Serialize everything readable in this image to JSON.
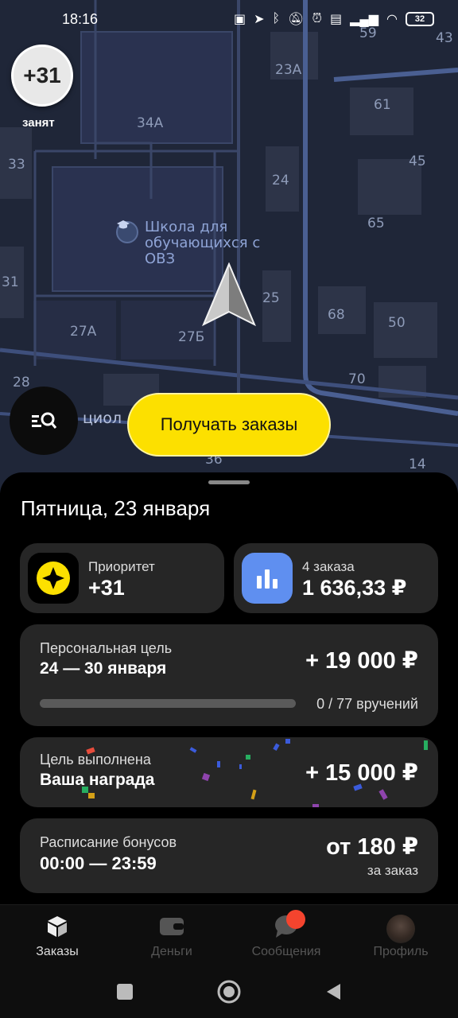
{
  "status_bar": {
    "time": "18:16",
    "battery": "32"
  },
  "map": {
    "labels": {
      "l_34a": "34А",
      "l_23a": "23А",
      "l_61": "61",
      "l_45": "45",
      "l_33": "33",
      "l_24": "24",
      "l_65": "65",
      "l_31": "31",
      "l_25": "25",
      "l_68": "68",
      "l_50": "50",
      "l_27a": "27А",
      "l_27b": "27Б",
      "l_70": "70",
      "l_28": "28",
      "l_36": "36",
      "l_14": "14",
      "l_43": "43",
      "l_59": "59",
      "street": "циол"
    },
    "poi_name": "Школа для обучающихся с ОВЗ"
  },
  "priority_badge": {
    "value": "+31",
    "status": "занят"
  },
  "get_orders_button": "Получать заказы",
  "panel": {
    "day_title": "Пятница, 23 января",
    "priority_tile": {
      "label": "Приоритет",
      "value": "+31"
    },
    "orders_tile": {
      "label": "4 заказа",
      "value": "1 636,33 ₽"
    },
    "personal_goal": {
      "label": "Персональная цель",
      "range": "24 — 30 января",
      "amount": "+ 19 000 ₽",
      "progress_text": "0 / 77 вручений",
      "progress_fraction": 0
    },
    "reward": {
      "label": "Цель выполнена",
      "title": "Ваша награда",
      "amount": "+ 15 000 ₽"
    },
    "schedule": {
      "label": "Расписание бонусов",
      "hours": "00:00 — 23:59",
      "amount": "от 180 ₽",
      "per": "за заказ"
    }
  },
  "bottom_nav": {
    "items": [
      {
        "label": "Заказы",
        "icon": "box-icon",
        "active": true
      },
      {
        "label": "Деньги",
        "icon": "wallet-icon",
        "active": false
      },
      {
        "label": "Сообщения",
        "icon": "chat-icon",
        "active": false
      },
      {
        "label": "Профиль",
        "icon": "avatar",
        "active": false
      }
    ]
  },
  "colors": {
    "accent": "#fce000",
    "panel_bg": "#000000",
    "card_bg": "#262626",
    "map_bg": "#1f2638",
    "notification": "#f4442e"
  }
}
